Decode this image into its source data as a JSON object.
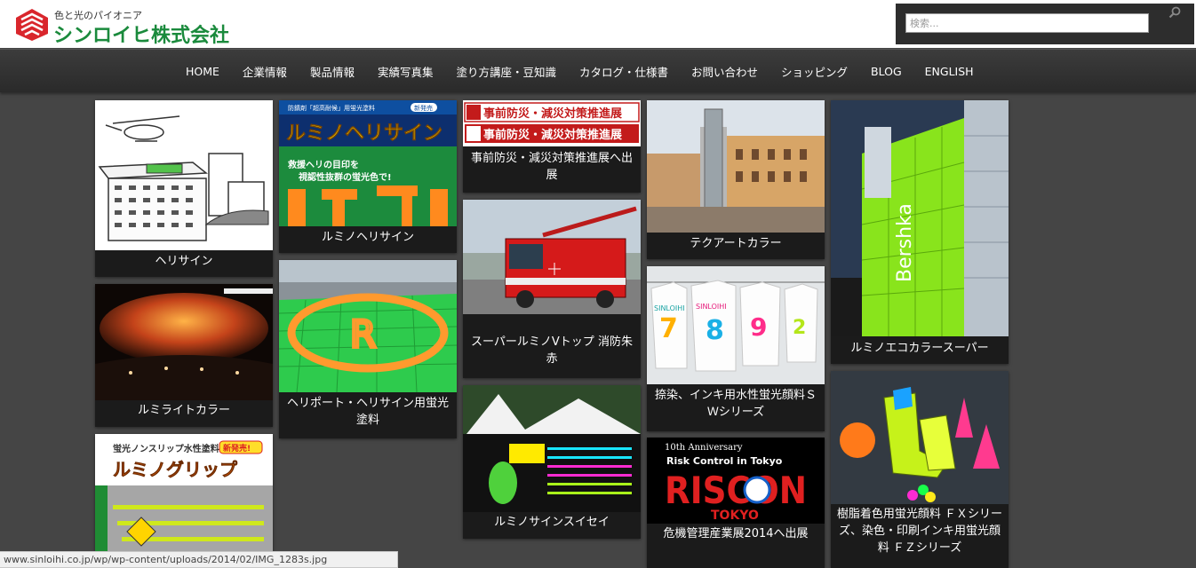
{
  "header": {
    "logo_tagline": "色と光のパイオニア",
    "logo_name": "シンロイヒ株式会社",
    "brand_color": "#d9262c",
    "search_placeholder": "検索..."
  },
  "nav": {
    "items": [
      {
        "label": "HOME"
      },
      {
        "label": "企業情報"
      },
      {
        "label": "製品情報"
      },
      {
        "label": "実績写真集"
      },
      {
        "label": "塗り方講座・豆知識"
      },
      {
        "label": "カタログ・仕様書"
      },
      {
        "label": "お問い合わせ"
      },
      {
        "label": "ショッピング"
      },
      {
        "label": "BLOG"
      },
      {
        "label": "ENGLISH"
      }
    ]
  },
  "tiles": {
    "heli_sign": {
      "caption": "ヘリサイン"
    },
    "lumi_light": {
      "caption": "ルミライトカラー"
    },
    "lumi_grip": {
      "caption": "",
      "banner_sub": "蛍光ノンスリップ水性塗料",
      "banner_new": "新発売!",
      "banner_title": "ルミノグリップ"
    },
    "lumino_heli": {
      "caption": "ルミノヘリサイン",
      "banner_sub": "防錆剤「超高耐候」用蛍光塗料",
      "banner_new": "新発売",
      "banner_title": "ルミノヘリサイン",
      "banner_copy1": "救援ヘリの目印を",
      "banner_copy2": "視認性抜群の蛍光色で!"
    },
    "heliport": {
      "caption": "ヘリポート・ヘリサイン用蛍光塗料"
    },
    "bousai": {
      "caption": "事前防災・減災対策推進展へ出展",
      "banner_line": "事前防災・減災対策推進展"
    },
    "fire_truck": {
      "caption": "スーパールミノVトップ 消防朱赤"
    },
    "signs": {
      "caption": "ルミノサインスイセイ"
    },
    "tecart": {
      "caption": "テクアートカラー"
    },
    "tshirts": {
      "caption": "捺染、インキ用水性蛍光顔料ＳＷシリーズ",
      "shirt_text": "SINLOIHI"
    },
    "riscon": {
      "caption": "危機管理産業展2014へ出展",
      "anniv": "10th Anniversary",
      "line": "Risk Control in Tokyo",
      "logo": "RISCON",
      "city": "TOKYO"
    },
    "bershka": {
      "caption": "ルミノエコカラースーパー",
      "sign": "Bershka"
    },
    "resin": {
      "caption": "樹脂着色用蛍光顔料 ＦＸシリーズ、染色・印刷インキ用蛍光顔料 ＦＺシリーズ"
    }
  },
  "statusbar": {
    "url": "www.sinloihi.co.jp/wp/wp-content/uploads/2014/02/IMG_1283s.jpg"
  }
}
